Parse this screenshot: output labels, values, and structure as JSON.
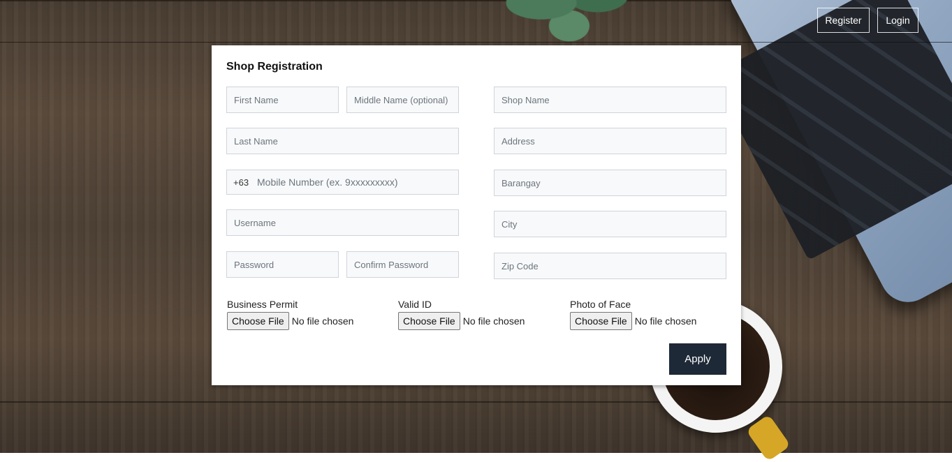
{
  "nav": {
    "register_label": "Register",
    "login_label": "Login"
  },
  "form": {
    "title": "Shop Registration",
    "first_name": {
      "placeholder": "First Name",
      "value": ""
    },
    "middle_name": {
      "placeholder": "Middle Name (optional)",
      "value": ""
    },
    "last_name": {
      "placeholder": "Last Name",
      "value": ""
    },
    "mobile": {
      "prefix": "+63",
      "placeholder": "Mobile Number (ex. 9xxxxxxxxx)",
      "value": ""
    },
    "username": {
      "placeholder": "Username",
      "value": ""
    },
    "password": {
      "placeholder": "Password",
      "value": ""
    },
    "confirm_password": {
      "placeholder": "Confirm Password",
      "value": ""
    },
    "shop_name": {
      "placeholder": "Shop Name",
      "value": ""
    },
    "address": {
      "placeholder": "Address",
      "value": ""
    },
    "barangay": {
      "placeholder": "Barangay",
      "value": ""
    },
    "city": {
      "placeholder": "City",
      "value": ""
    },
    "zip_code": {
      "placeholder": "Zip Code",
      "value": ""
    },
    "uploads": [
      {
        "label": "Business Permit",
        "button": "Choose File",
        "status": "No file chosen"
      },
      {
        "label": "Valid ID",
        "button": "Choose File",
        "status": "No file chosen"
      },
      {
        "label": "Photo of Face",
        "button": "Choose File",
        "status": "No file chosen"
      }
    ],
    "apply_label": "Apply"
  },
  "colors": {
    "apply_bg": "#1e2937",
    "input_bg": "#f8f9fa",
    "input_border": "#cfd4da"
  }
}
